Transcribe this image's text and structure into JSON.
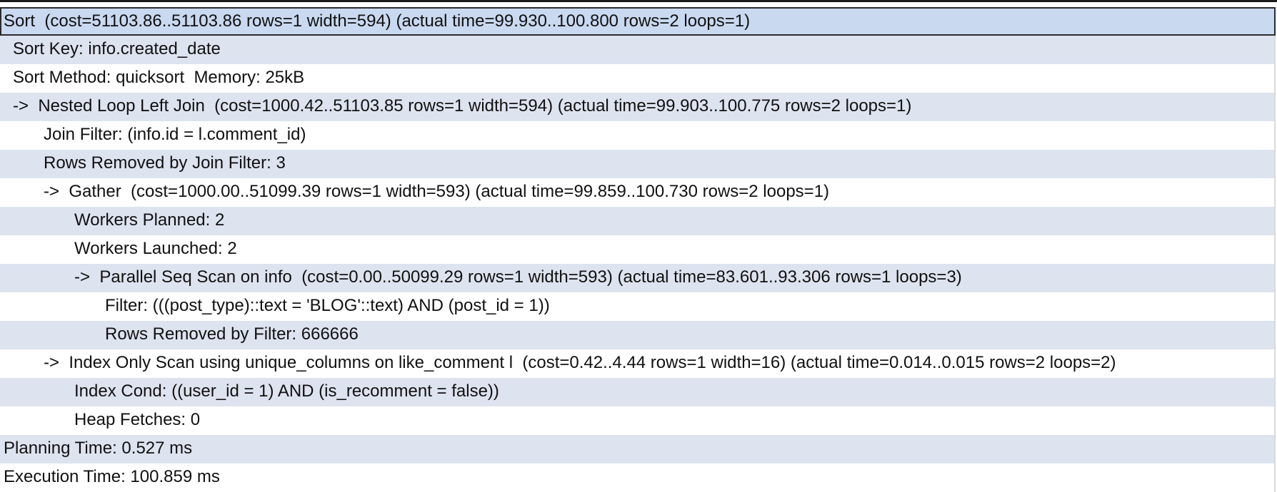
{
  "query_plan": {
    "rows": [
      {
        "text": "Sort  (cost=51103.86..51103.86 rows=1 width=594) (actual time=99.930..100.800 rows=2 loops=1)",
        "indent": 0,
        "selected": true
      },
      {
        "text": "Sort Key: info.created_date",
        "indent": 1
      },
      {
        "text": "Sort Method: quicksort  Memory: 25kB",
        "indent": 1
      },
      {
        "text": "->  Nested Loop Left Join  (cost=1000.42..51103.85 rows=1 width=594) (actual time=99.903..100.775 rows=2 loops=1)",
        "indent": 1
      },
      {
        "text": "Join Filter: (info.id = l.comment_id)",
        "indent": 2
      },
      {
        "text": "Rows Removed by Join Filter: 3",
        "indent": 2
      },
      {
        "text": "->  Gather  (cost=1000.00..51099.39 rows=1 width=593) (actual time=99.859..100.730 rows=2 loops=1)",
        "indent": 2
      },
      {
        "text": "Workers Planned: 2",
        "indent": 3
      },
      {
        "text": "Workers Launched: 2",
        "indent": 3
      },
      {
        "text": "->  Parallel Seq Scan on info  (cost=0.00..50099.29 rows=1 width=593) (actual time=83.601..93.306 rows=1 loops=3)",
        "indent": 3
      },
      {
        "text": "Filter: (((post_type)::text = 'BLOG'::text) AND (post_id = 1))",
        "indent": 4
      },
      {
        "text": "Rows Removed by Filter: 666666",
        "indent": 4
      },
      {
        "text": "->  Index Only Scan using unique_columns on like_comment l  (cost=0.42..4.44 rows=1 width=16) (actual time=0.014..0.015 rows=2 loops=2)",
        "indent": 2
      },
      {
        "text": "Index Cond: ((user_id = 1) AND (is_recomment = false))",
        "indent": 3
      },
      {
        "text": "Heap Fetches: 0",
        "indent": 3
      },
      {
        "text": "Planning Time: 0.527 ms",
        "indent": 0
      },
      {
        "text": "Execution Time: 100.859 ms",
        "indent": 0
      }
    ]
  },
  "colors": {
    "row_alt": "#dde3ef",
    "row_selected": "#c9d9f0",
    "row_plain": "#ffffff"
  }
}
